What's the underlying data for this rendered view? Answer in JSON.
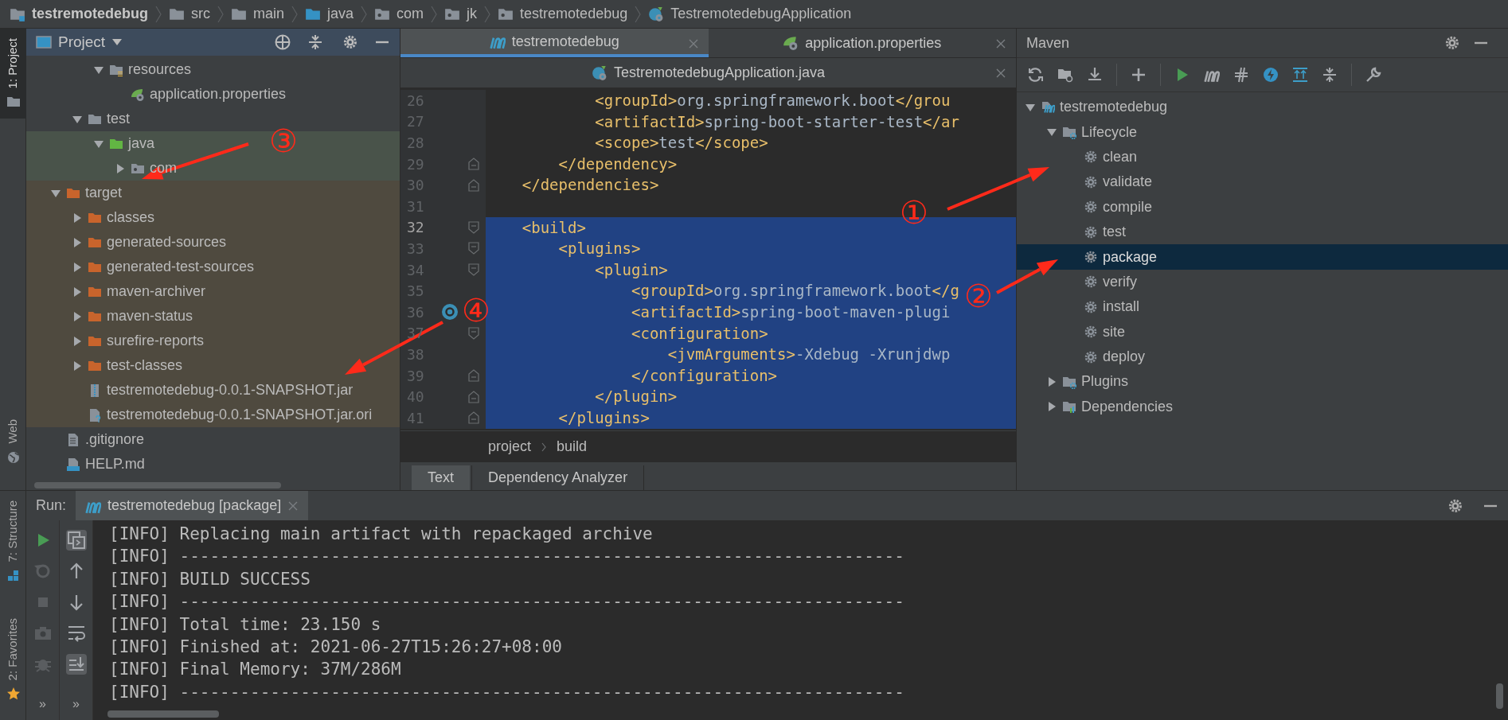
{
  "breadcrumb": [
    {
      "label": "testremotedebug",
      "kind": "module"
    },
    {
      "label": "src",
      "kind": "folder"
    },
    {
      "label": "main",
      "kind": "folder"
    },
    {
      "label": "java",
      "kind": "source"
    },
    {
      "label": "com",
      "kind": "package"
    },
    {
      "label": "jk",
      "kind": "package"
    },
    {
      "label": "testremotedebug",
      "kind": "package"
    },
    {
      "label": "TestremotedebugApplication",
      "kind": "class"
    }
  ],
  "left_stripe": {
    "top": [
      {
        "label": "1: Project",
        "kind": "folder",
        "selected": true
      },
      {
        "label": "Web",
        "kind": "globe",
        "selected": false
      }
    ],
    "bottom": [
      {
        "label": "7: Structure",
        "kind": "structure",
        "selected": false
      },
      {
        "label": "2: Favorites",
        "kind": "star",
        "selected": false
      }
    ]
  },
  "project_panel": {
    "title": "Project",
    "tree": [
      {
        "children": [
          {
            "children": [
              {
                "label": "resources",
                "kind": "resources",
                "expanded": true,
                "children": [
                  {
                    "label": "application.properties",
                    "kind": "properties"
                  }
                ]
              }
            ]
          },
          {
            "label": "test",
            "kind": "folder",
            "expanded": true,
            "children": [
              {
                "label": "java",
                "kind": "test-folder",
                "expanded": true,
                "color": "#49534a",
                "children": [
                  {
                    "label": "com",
                    "kind": "package",
                    "expanded": false,
                    "color": "#49534a"
                  }
                ]
              }
            ]
          }
        ]
      },
      {
        "label": "target",
        "kind": "excluded",
        "expanded": true,
        "color": "#4f4a3f",
        "children": [
          {
            "label": "classes",
            "kind": "excluded",
            "expanded": false,
            "color": "#4f4a3f"
          },
          {
            "label": "generated-sources",
            "kind": "excluded",
            "expanded": false,
            "color": "#4f4a3f"
          },
          {
            "label": "generated-test-sources",
            "kind": "excluded",
            "expanded": false,
            "color": "#4f4a3f"
          },
          {
            "label": "maven-archiver",
            "kind": "excluded",
            "expanded": false,
            "color": "#4f4a3f"
          },
          {
            "label": "maven-status",
            "kind": "excluded",
            "expanded": false,
            "color": "#4f4a3f"
          },
          {
            "label": "surefire-reports",
            "kind": "excluded",
            "expanded": false,
            "color": "#4f4a3f"
          },
          {
            "label": "test-classes",
            "kind": "excluded",
            "expanded": false,
            "color": "#4f4a3f"
          },
          {
            "label": "testremotedebug-0.0.1-SNAPSHOT.jar",
            "kind": "jar",
            "color": "#4f4a3f"
          },
          {
            "label": "testremotedebug-0.0.1-SNAPSHOT.jar.ori",
            "kind": "unknown",
            "color": "#4f4a3f"
          }
        ]
      },
      {
        "label": ".gitignore",
        "kind": "text"
      },
      {
        "label": "HELP.md",
        "kind": "markdown"
      }
    ]
  },
  "editor": {
    "tabs": [
      {
        "label": "testremotedebug",
        "kind": "maven",
        "selected": true
      },
      {
        "label": "application.properties",
        "kind": "properties",
        "selected": false
      },
      {
        "label": "TestremotedebugApplication.java",
        "kind": "class",
        "selected": false
      }
    ],
    "lines": [
      {
        "number": "26",
        "code": "            <groupId>org.springframework.boot</grou",
        "selected": false,
        "kind": "plain"
      },
      {
        "number": "27",
        "code": "            <artifactId>spring-boot-starter-test</ar",
        "selected": false,
        "kind": "plain"
      },
      {
        "number": "28",
        "code": "            <scope>test</scope>",
        "selected": false,
        "kind": "plain"
      },
      {
        "number": "29",
        "code": "        </dependency>",
        "selected": false,
        "kind": "fold-end"
      },
      {
        "number": "30",
        "code": "    </dependencies>",
        "selected": false,
        "kind": "fold-end"
      },
      {
        "number": "31",
        "selected": false,
        "kind": "plain"
      },
      {
        "number": "32",
        "code": "    <build>",
        "selected": true,
        "current": true,
        "kind": "fold-start"
      },
      {
        "number": "33",
        "code": "        <plugins>",
        "selected": true,
        "kind": "fold-start"
      },
      {
        "number": "34",
        "code": "            <plugin>",
        "selected": true,
        "kind": "fold-start"
      },
      {
        "number": "35",
        "code": "                <groupId>org.springframework.boot</g",
        "selected": true,
        "kind": "plain"
      },
      {
        "number": "36",
        "code": "                <artifactId>spring-boot-maven-plugi",
        "selected": true,
        "marker": true,
        "kind": "plain"
      },
      {
        "number": "37",
        "code": "                <configuration>",
        "selected": true,
        "kind": "fold-start"
      },
      {
        "number": "38",
        "code": "                    <jvmArguments>-Xdebug -Xrunjdwp",
        "selected": true,
        "kind": "plain"
      },
      {
        "number": "39",
        "code": "                </configuration>",
        "selected": true,
        "kind": "fold-end"
      },
      {
        "number": "40",
        "code": "            </plugin>",
        "selected": true,
        "kind": "fold-end"
      },
      {
        "number": "41",
        "code": "        </plugins>",
        "selected": true,
        "kind": "fold-end"
      }
    ],
    "breadcrumb": [
      "project",
      "build"
    ],
    "bottom_tabs": [
      {
        "label": "Text",
        "selected": true
      },
      {
        "label": "Dependency Analyzer",
        "selected": false
      }
    ]
  },
  "maven": {
    "title": "Maven",
    "tree": [
      {
        "label": "testremotedebug",
        "kind": "project",
        "expanded": true,
        "selected": false,
        "children": [
          {
            "label": "Lifecycle",
            "kind": "group",
            "expanded": true,
            "selected": false,
            "children": [
              {
                "label": "clean",
                "kind": "goal",
                "selected": false
              },
              {
                "label": "validate",
                "kind": "goal",
                "selected": false
              },
              {
                "label": "compile",
                "kind": "goal",
                "selected": false
              },
              {
                "label": "test",
                "kind": "goal",
                "selected": false
              },
              {
                "label": "package",
                "kind": "goal",
                "selected": true
              },
              {
                "label": "verify",
                "kind": "goal",
                "selected": false
              },
              {
                "label": "install",
                "kind": "goal",
                "selected": false
              },
              {
                "label": "site",
                "kind": "goal",
                "selected": false
              },
              {
                "label": "deploy",
                "kind": "goal",
                "selected": false
              }
            ]
          },
          {
            "label": "Plugins",
            "kind": "group",
            "expanded": false,
            "selected": false
          },
          {
            "label": "Dependencies",
            "kind": "deps",
            "expanded": false,
            "selected": false
          }
        ]
      }
    ]
  },
  "run": {
    "label": "Run:",
    "tab": "testremotedebug [package]",
    "overflow": [
      "»",
      "»"
    ],
    "lines": [
      "[INFO] Replacing main artifact with repackaged archive",
      "[INFO] ------------------------------------------------------------------------",
      "[INFO] BUILD SUCCESS",
      "[INFO] ------------------------------------------------------------------------",
      "[INFO] Total time: 23.150 s",
      "[INFO] Finished at: 2021-06-27T15:26:27+08:00",
      "[INFO] Final Memory: 37M/286M",
      "[INFO] ------------------------------------------------------------------------"
    ]
  },
  "annotations": [
    {
      "label": "①"
    },
    {
      "label": "②"
    },
    {
      "label": "③"
    },
    {
      "label": "④"
    }
  ]
}
